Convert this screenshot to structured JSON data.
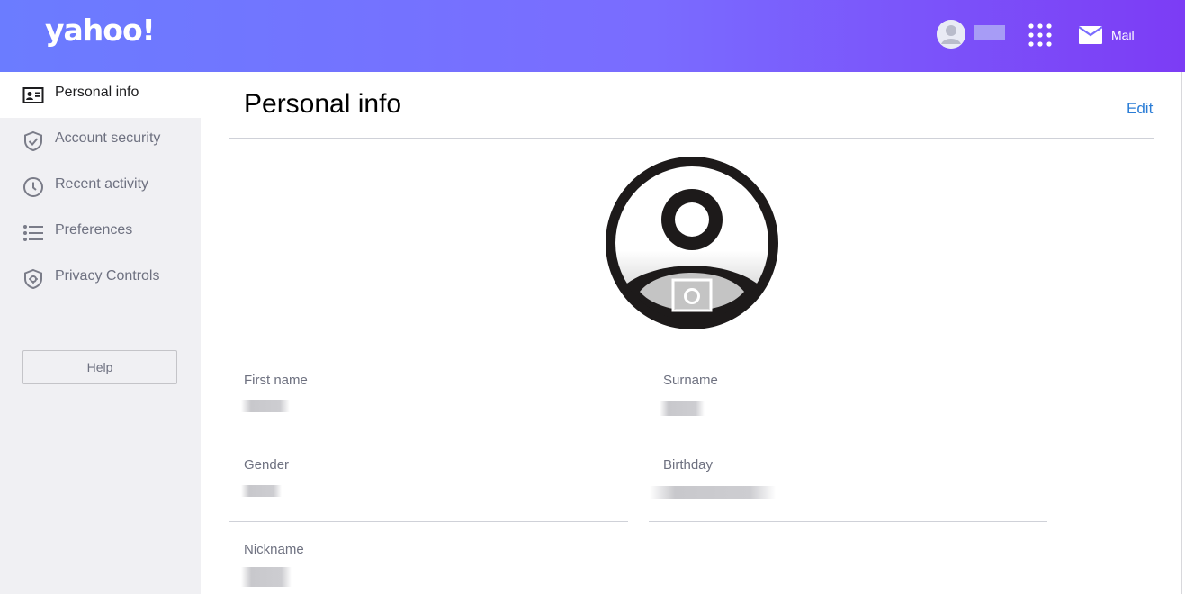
{
  "header": {
    "logo": "yahoo!",
    "mail_label": "Mail"
  },
  "sidebar": {
    "items": [
      {
        "label": "Personal info",
        "icon": "id-card-icon",
        "active": true
      },
      {
        "label": "Account security",
        "icon": "shield-check-icon",
        "active": false
      },
      {
        "label": "Recent activity",
        "icon": "clock-icon",
        "active": false
      },
      {
        "label": "Preferences",
        "icon": "list-icon",
        "active": false
      },
      {
        "label": "Privacy Controls",
        "icon": "privacy-shield-icon",
        "active": false
      }
    ],
    "help_label": "Help"
  },
  "main": {
    "title": "Personal info",
    "edit_label": "Edit",
    "fields": {
      "first_name_label": "First name",
      "surname_label": "Surname",
      "gender_label": "Gender",
      "birthday_label": "Birthday",
      "nickname_label": "Nickname"
    }
  },
  "colors": {
    "header_gradient_start": "#6b7cff",
    "header_gradient_end": "#7c3cf5",
    "link": "#2b7dd6",
    "sidebar_bg": "#f0f0f3"
  }
}
